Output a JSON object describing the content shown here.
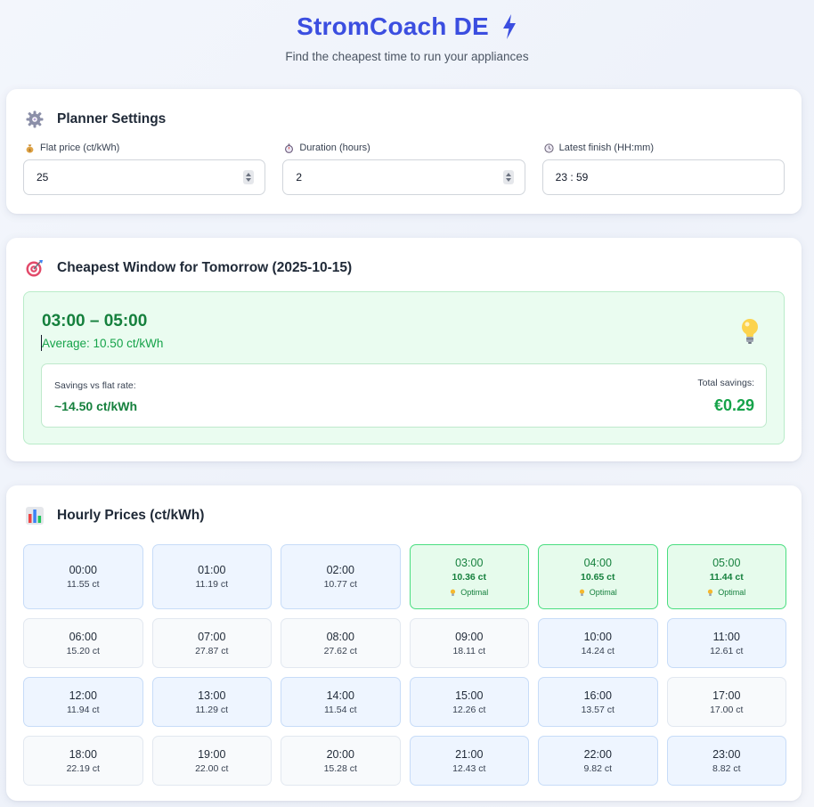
{
  "header": {
    "title": "StromCoach DE",
    "subtitle": "Find the cheapest time to run your appliances",
    "title_icon": "bolt-icon"
  },
  "settings": {
    "title": "Planner Settings",
    "icon": "gear-icon",
    "fields": [
      {
        "label": "Flat price (ct/kWh)",
        "icon": "money-bag-icon",
        "value": "25"
      },
      {
        "label": "Duration (hours)",
        "icon": "stopwatch-icon",
        "value": "2"
      },
      {
        "label": "Latest finish (HH:mm)",
        "icon": "clock-icon",
        "value": "23 : 59"
      }
    ]
  },
  "cheapest": {
    "title": "Cheapest Window for Tomorrow (2025-10-15)",
    "icon": "target-icon",
    "window": "03:00 – 05:00",
    "average": "Average: 10.50 ct/kWh",
    "savings_label": "Savings vs flat rate:",
    "savings_value": "~14.50 ct/kWh",
    "total_label": "Total savings:",
    "total_value": "€0.29"
  },
  "hourly": {
    "title": "Hourly Prices (ct/kWh)",
    "icon": "bar-chart-icon",
    "optimal_label": "Optimal",
    "hours": [
      {
        "time": "00:00",
        "price": "11.55 ct",
        "state": "low"
      },
      {
        "time": "01:00",
        "price": "11.19 ct",
        "state": "low"
      },
      {
        "time": "02:00",
        "price": "10.77 ct",
        "state": "low"
      },
      {
        "time": "03:00",
        "price": "10.36 ct",
        "state": "optimal"
      },
      {
        "time": "04:00",
        "price": "10.65 ct",
        "state": "optimal"
      },
      {
        "time": "05:00",
        "price": "11.44 ct",
        "state": "optimal"
      },
      {
        "time": "06:00",
        "price": "15.20 ct",
        "state": "neutral"
      },
      {
        "time": "07:00",
        "price": "27.87 ct",
        "state": "neutral"
      },
      {
        "time": "08:00",
        "price": "27.62 ct",
        "state": "neutral"
      },
      {
        "time": "09:00",
        "price": "18.11 ct",
        "state": "neutral"
      },
      {
        "time": "10:00",
        "price": "14.24 ct",
        "state": "low"
      },
      {
        "time": "11:00",
        "price": "12.61 ct",
        "state": "low"
      },
      {
        "time": "12:00",
        "price": "11.94 ct",
        "state": "low"
      },
      {
        "time": "13:00",
        "price": "11.29 ct",
        "state": "low"
      },
      {
        "time": "14:00",
        "price": "11.54 ct",
        "state": "low"
      },
      {
        "time": "15:00",
        "price": "12.26 ct",
        "state": "low"
      },
      {
        "time": "16:00",
        "price": "13.57 ct",
        "state": "low"
      },
      {
        "time": "17:00",
        "price": "17.00 ct",
        "state": "neutral"
      },
      {
        "time": "18:00",
        "price": "22.19 ct",
        "state": "neutral"
      },
      {
        "time": "19:00",
        "price": "22.00 ct",
        "state": "neutral"
      },
      {
        "time": "20:00",
        "price": "15.28 ct",
        "state": "neutral"
      },
      {
        "time": "21:00",
        "price": "12.43 ct",
        "state": "low"
      },
      {
        "time": "22:00",
        "price": "9.82 ct",
        "state": "low"
      },
      {
        "time": "23:00",
        "price": "8.82 ct",
        "state": "low"
      }
    ]
  }
}
